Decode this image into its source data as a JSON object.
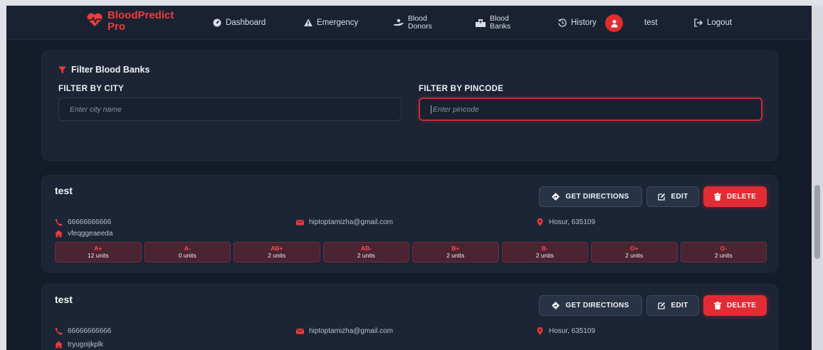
{
  "nav": {
    "brand_line1": "BloodPredict",
    "brand_line2": "Pro",
    "brand_color": "#ef3b3b",
    "items": [
      {
        "label": "Dashboard",
        "icon": "dashboard-gauge-icon"
      },
      {
        "label": "Emergency",
        "icon": "warning-triangle-icon"
      },
      {
        "label_1": "Blood",
        "label_2": "Donors",
        "icon": "donors-hand-icon"
      },
      {
        "label_1": "Blood",
        "label_2": "Banks",
        "icon": "hospital-icon"
      },
      {
        "label": "History",
        "icon": "history-clock-icon"
      }
    ],
    "user": "test",
    "logout": "Logout"
  },
  "filter": {
    "title": "Filter Blood Banks",
    "city_label": "FILTER BY CITY",
    "city_placeholder": "Enter city name",
    "pincode_label": "FILTER BY PINCODE",
    "pincode_placeholder": "Enter pincode"
  },
  "actions": {
    "directions": "GET DIRECTIONS",
    "edit": "EDIT",
    "delete": "DELETE"
  },
  "banks": [
    {
      "name": "test",
      "phone": "66666666666",
      "email": "hiptoptamizha@gmail.com",
      "location": "Hosur, 635109",
      "address": "vfeqggeaeeda",
      "stock": [
        {
          "group": "A+",
          "units": "12 units"
        },
        {
          "group": "A-",
          "units": "0 units"
        },
        {
          "group": "AB+",
          "units": "2 units"
        },
        {
          "group": "AB-",
          "units": "2 units"
        },
        {
          "group": "B+",
          "units": "2 units"
        },
        {
          "group": "B-",
          "units": "2 units"
        },
        {
          "group": "O+",
          "units": "2 units"
        },
        {
          "group": "O-",
          "units": "2 units"
        }
      ]
    },
    {
      "name": "test",
      "phone": "66666666666",
      "email": "hiptoptamizha@gmail.com",
      "location": "Hosur, 635109",
      "address": "tryugoijkplk"
    }
  ]
}
